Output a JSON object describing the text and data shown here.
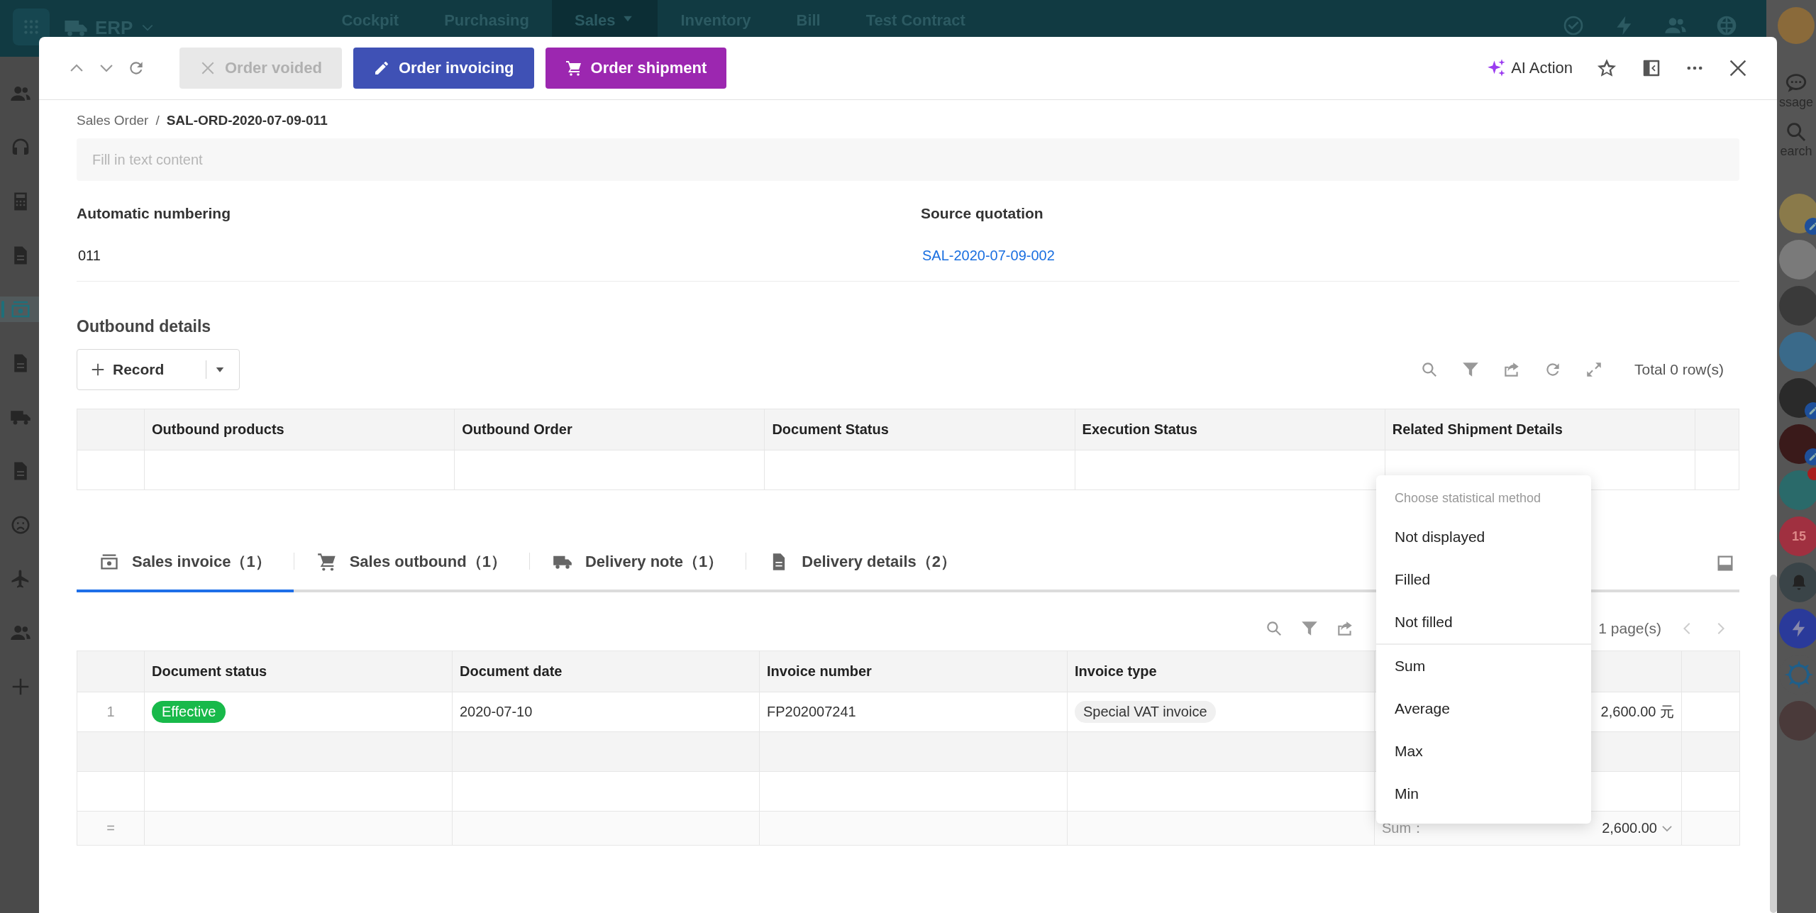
{
  "app_bar": {
    "title": "ERP",
    "nav": [
      {
        "label": "Cockpit",
        "selected": false,
        "has_menu": false
      },
      {
        "label": "Purchasing",
        "selected": false,
        "has_menu": false
      },
      {
        "label": "Sales",
        "selected": true,
        "has_menu": true
      },
      {
        "label": "Inventory",
        "selected": false,
        "has_menu": false
      },
      {
        "label": "Bill",
        "selected": false,
        "has_menu": false
      },
      {
        "label": "Test Contract",
        "selected": false,
        "has_menu": false
      }
    ]
  },
  "left_rail": {
    "items": [
      {
        "kind": "users",
        "selected": false
      },
      {
        "kind": "headset",
        "selected": false
      },
      {
        "kind": "calculator",
        "selected": false
      },
      {
        "kind": "document",
        "selected": false
      },
      {
        "kind": "money",
        "selected": true
      },
      {
        "kind": "document",
        "selected": false
      },
      {
        "kind": "truck",
        "selected": false
      },
      {
        "kind": "document",
        "selected": false
      },
      {
        "kind": "sad-face",
        "selected": false
      },
      {
        "kind": "plane",
        "selected": false
      },
      {
        "kind": "users",
        "selected": false
      },
      {
        "kind": "plus",
        "selected": false
      }
    ]
  },
  "right_rail": {
    "message_label": "ssage",
    "search_label": "earch",
    "items": [
      {
        "kind": "avatar",
        "color": "#8a7a4a",
        "edit_badge": true,
        "alert_dot": false
      },
      {
        "kind": "avatar",
        "color": "#7a7a7a",
        "edit_badge": false,
        "alert_dot": false
      },
      {
        "kind": "avatar",
        "color": "#3a3a3a",
        "edit_badge": false,
        "alert_dot": false
      },
      {
        "kind": "avatar",
        "color": "#3a6a8a",
        "edit_badge": false,
        "alert_dot": false
      },
      {
        "kind": "avatar",
        "color": "#2a2a2a",
        "edit_badge": true,
        "alert_dot": false
      },
      {
        "kind": "avatar",
        "color": "#3a1a1a",
        "edit_badge": true,
        "alert_dot": false
      },
      {
        "kind": "avatar",
        "color": "#2a6a6a",
        "edit_badge": false,
        "alert_dot": true
      },
      {
        "kind": "calendar",
        "color": "#a03040",
        "edit_badge": false,
        "alert_dot": false,
        "text": "15"
      },
      {
        "kind": "bell",
        "color": "#3a4448",
        "edit_badge": false,
        "alert_dot": false
      },
      {
        "kind": "bolt",
        "color": "#2a3a9a",
        "edit_badge": false,
        "alert_dot": false
      },
      {
        "kind": "helm",
        "color": "#555555",
        "edit_badge": false,
        "alert_dot": false
      },
      {
        "kind": "avatar",
        "color": "#4a3a3a",
        "edit_badge": false,
        "alert_dot": false
      }
    ]
  },
  "modal": {
    "buttons": [
      {
        "label": "Order voided",
        "kind": "void",
        "disabled": true,
        "color": "#e8e8e8"
      },
      {
        "label": "Order invoicing",
        "kind": "edit",
        "disabled": false,
        "color": "#3f51b5"
      },
      {
        "label": "Order shipment",
        "kind": "cart",
        "disabled": false,
        "color": "#9c27b0"
      }
    ],
    "ai_action": "AI Action",
    "breadcrumb": {
      "parent": "Sales Order",
      "separator": "/",
      "current": "SAL-ORD-2020-07-09-011"
    },
    "notes": {
      "placeholder": "Fill in text content"
    },
    "fields": [
      {
        "label": "Automatic numbering",
        "value": "011",
        "kind": "text"
      },
      {
        "label": "Source quotation",
        "value": "SAL-2020-07-09-002",
        "kind": "link"
      }
    ],
    "outbound": {
      "title": "Outbound details",
      "record_button": "Record",
      "total": "Total 0 row(s)",
      "columns": [
        "Outbound products",
        "Outbound Order",
        "Document Status",
        "Execution Status",
        "Related Shipment Details"
      ]
    },
    "tabs": [
      {
        "label": "Sales invoice（1）",
        "kind": "invoice",
        "selected": true
      },
      {
        "label": "Sales outbound（1）",
        "kind": "cart",
        "selected": false
      },
      {
        "label": "Delivery note（1）",
        "kind": "truck",
        "selected": false
      },
      {
        "label": "Delivery details（2）",
        "kind": "document",
        "selected": false
      }
    ],
    "invoices": {
      "pager": "1 page(s)",
      "columns": [
        "Document status",
        "Document date",
        "Invoice number",
        "Invoice type"
      ],
      "rows": [
        {
          "index": "1",
          "status": "Effective",
          "date": "2020-07-10",
          "number": "FP202007241",
          "type": "Special VAT invoice",
          "amount": "2,600.00 元"
        }
      ],
      "summary": {
        "marker": "=",
        "label": "Sum：",
        "value": "2,600.00"
      }
    },
    "stat_menu": {
      "title": "Choose statistical method",
      "groups": [
        [
          "Not displayed",
          "Filled",
          "Not filled"
        ],
        [
          "Sum",
          "Average",
          "Max",
          "Min"
        ]
      ]
    }
  }
}
